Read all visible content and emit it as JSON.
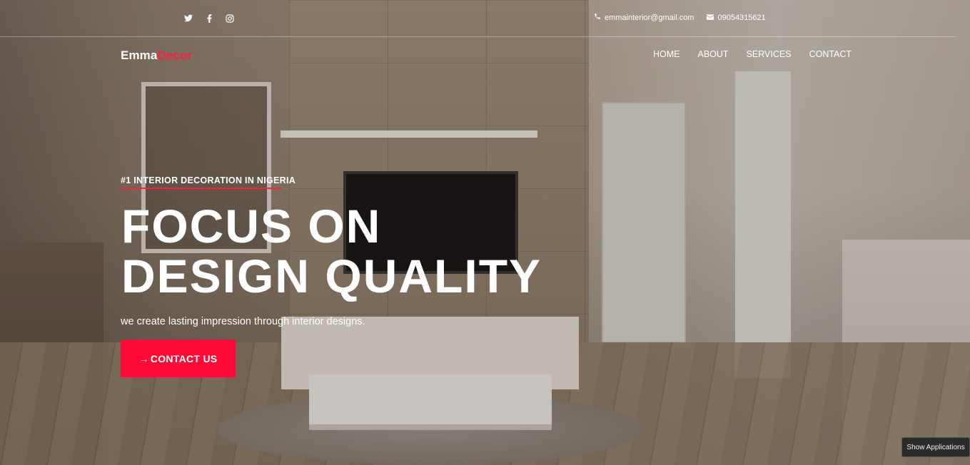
{
  "topbar": {
    "social_icons": [
      "twitter-icon",
      "facebook-icon",
      "instagram-icon"
    ],
    "email": "emmainterior@gmail.com",
    "phone": "09054315621"
  },
  "brand": {
    "part1": "Emma",
    "part2": "Decor"
  },
  "nav": {
    "items": [
      "HOME",
      "ABOUT",
      "SERVICES",
      "CONTACT"
    ]
  },
  "hero": {
    "kicker": "#1 INTERIOR DECORATION IN NIGERIA",
    "headline_line1": "FOCUS ON",
    "headline_line2": "DESIGN QUALITY",
    "subtitle": "we create lasting impression through interior designs.",
    "cta_arrow": "→",
    "cta_label": "CONTACT US"
  },
  "taskbar": {
    "show_apps_label": "Show Applications"
  },
  "colors": {
    "accent": "#ff1e3c",
    "cta_bg": "#ff0a36"
  }
}
